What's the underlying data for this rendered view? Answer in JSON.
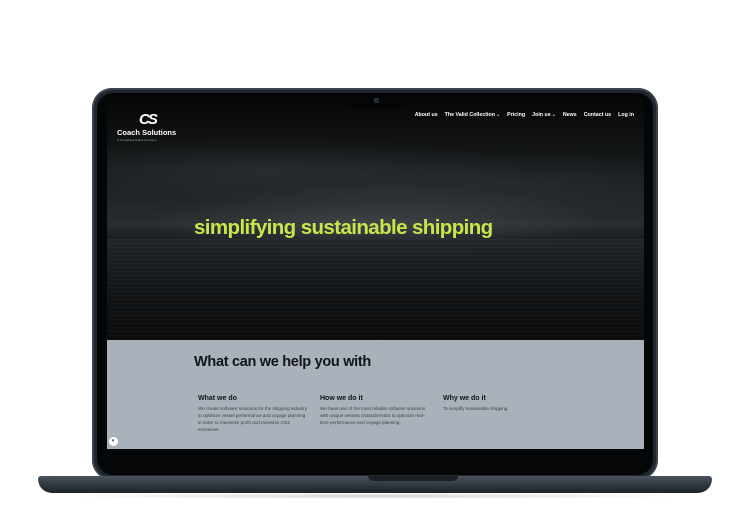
{
  "brand": {
    "mark": "CS",
    "name": "Coach Solutions",
    "tagline": "A Kongsberg Digital company"
  },
  "nav": {
    "items": [
      {
        "label": "About us",
        "dropdown": false
      },
      {
        "label": "The Valid Collection",
        "dropdown": true
      },
      {
        "label": "Pricing",
        "dropdown": false
      },
      {
        "label": "Join us",
        "dropdown": true
      },
      {
        "label": "News",
        "dropdown": false
      },
      {
        "label": "Contact us",
        "dropdown": false
      },
      {
        "label": "Log in",
        "dropdown": false
      }
    ],
    "chevron": "⌄"
  },
  "hero": {
    "headline": "simplifying sustainable shipping",
    "headline_color": "#c6e64a"
  },
  "info": {
    "title": "What can we help you with",
    "columns": [
      {
        "title": "What we do",
        "text": "We create software solutions for the shipping industry to optimize vessel performance and voyage planning in order to maximize profit and minimize CO2 emissions."
      },
      {
        "title": "How we do it",
        "text": "We have one of the most reliable software solutions with unique vessels characteristics to optimize real-time performance and voyage planning."
      },
      {
        "title": "Why we do it",
        "text": "To simplify sustainable shipping."
      }
    ]
  },
  "chat": {
    "icon": "chat-icon",
    "glyph": "◐"
  },
  "colors": {
    "accent": "#c6e64a",
    "info_bg": "#a9b2ba",
    "device": "#20262d"
  }
}
